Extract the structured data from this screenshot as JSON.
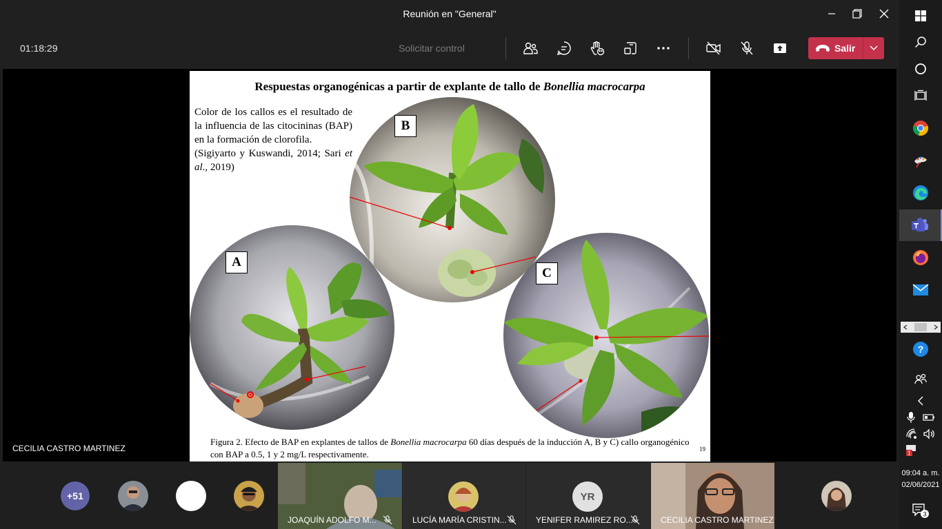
{
  "window": {
    "title": "Reunión en \"General\""
  },
  "toolbar": {
    "timer": "01:18:29",
    "request_control": "Solicitar control",
    "leave_label": "Salir"
  },
  "stage": {
    "presenter_name": "CECILIA CASTRO MARTINEZ"
  },
  "slide": {
    "title_prefix": "Respuestas organogénicas a partir de explante de tallo de ",
    "title_species": "Bonellia macrocarpa",
    "body_text": "Color de los callos es el resultado de la influencia de las citocininas (BAP) en la formación de clorofila.",
    "citation_a": "(Sigiyarto y Kuswandi, 2014; Sari ",
    "citation_etal": "et al",
    "citation_b": "., 2019)",
    "panel_labels": [
      "A",
      "B",
      "C"
    ],
    "caption_a": "Figura 2. Efecto de BAP en explantes de tallos de ",
    "caption_species": "Bonellia macrocarpa",
    "caption_b": " 60 días después de la inducción A, B y C) callo organogénico con BAP a 0.5, 1 y 2 mg/L respectivamente.",
    "slide_number": "19"
  },
  "participants": {
    "overflow_count": "+51",
    "tiles": [
      {
        "name": "JOAQUÍN ADOLFO M..."
      },
      {
        "name": "LUCÍA MARÍA CRISTIN..."
      },
      {
        "name": "YENIFER RAMIREZ RO...",
        "initials": "YR"
      },
      {
        "name": "CECILIA CASTRO MARTINEZ"
      }
    ]
  },
  "taskbar": {
    "clock_time": "09:04 a. m.",
    "clock_date": "02/06/2021",
    "notification_count": "3",
    "tray_badge": "1"
  },
  "colors": {
    "leave": "#c4314b",
    "teams_purple": "#6264a7",
    "background": "#1f1f1f"
  }
}
